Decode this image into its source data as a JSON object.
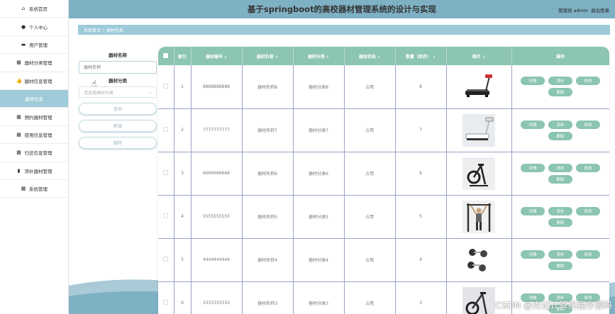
{
  "header": {
    "title": "基于springboot的高校器材管理系统的设计与实现",
    "user_label": "管理员 admin",
    "logout_label": "退出登录"
  },
  "sidebar": {
    "items": [
      {
        "label": "系统首页",
        "icon": "home-icon",
        "active": false
      },
      {
        "label": "个人中心",
        "icon": "user-icon",
        "active": false
      },
      {
        "label": "用户管理",
        "icon": "monitor-icon",
        "active": false
      },
      {
        "label": "器材分类管理",
        "icon": "grid-icon",
        "active": false
      },
      {
        "label": "器材信息管理",
        "icon": "thumb-icon",
        "active": false
      },
      {
        "label": "器材信息",
        "icon": "",
        "active": true
      },
      {
        "label": "预约器材管理",
        "icon": "grid-icon",
        "active": false
      },
      {
        "label": "使用信息管理",
        "icon": "grid-icon",
        "active": false
      },
      {
        "label": "归还信息管理",
        "icon": "grid-icon",
        "active": false
      },
      {
        "label": "添补器材管理",
        "icon": "bar-chart-icon",
        "active": false
      },
      {
        "label": "系统管理",
        "icon": "grid-icon",
        "active": false
      }
    ]
  },
  "breadcrumb": {
    "home": "系统首页",
    "separator": "/",
    "current": "器材信息"
  },
  "search": {
    "name_label": "器材名称",
    "name_placeholder": "器材名称",
    "category_label": "器材分类",
    "category_placeholder": "请选择器材分类",
    "query_button": "查询",
    "add_button": "新增",
    "delete_button": "删除"
  },
  "table": {
    "columns": [
      "",
      "索引",
      "器材编号",
      "器材名称",
      "器材分类",
      "器材状态",
      "数量（库存）",
      "图片",
      "操作"
    ],
    "operations": [
      "详情",
      "添补",
      "修改",
      "删除"
    ],
    "rows": [
      {
        "index": "1",
        "code": "8888888888",
        "name": "器材名称8",
        "category": "器材分类8",
        "status": "占用",
        "quantity": "8",
        "image": "treadmill"
      },
      {
        "index": "2",
        "code": "7777777777",
        "name": "器材名称7",
        "category": "器材分类7",
        "status": "占用",
        "quantity": "7",
        "image": "treadmill-white"
      },
      {
        "index": "3",
        "code": "6666666666",
        "name": "器材名称6",
        "category": "器材分类6",
        "status": "占用",
        "quantity": "6",
        "image": "exercise-bike"
      },
      {
        "index": "4",
        "code": "5555555555",
        "name": "器材名称5",
        "category": "器材分类5",
        "status": "占用",
        "quantity": "5",
        "image": "pull-up-station"
      },
      {
        "index": "5",
        "code": "4444444444",
        "name": "器材名称4",
        "category": "器材分类4",
        "status": "占用",
        "quantity": "4",
        "image": "dumbbells"
      },
      {
        "index": "6",
        "code": "3333333333",
        "name": "器材名称3",
        "category": "器材分类3",
        "status": "占用",
        "quantity": "3",
        "image": "spin-bike"
      }
    ]
  },
  "watermark": "CSDN @杰记计算机程序源码",
  "colors": {
    "header": "#7fb1c4",
    "accent": "#8cc5b1",
    "active_menu": "#9fcbd8"
  }
}
